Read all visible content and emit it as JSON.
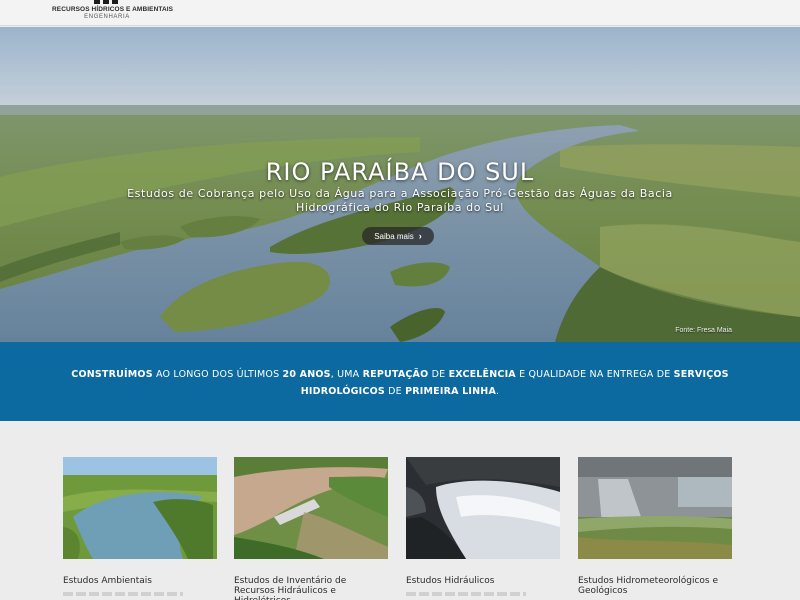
{
  "header": {
    "logo_line1": "RECURSOS HÍDRICOS E AMBIENTAIS",
    "logo_line2": "ENGENHARIA"
  },
  "hero": {
    "title": "RIO PARAÍBA DO SUL",
    "subtitle": "Estudos de Cobrança pelo Uso da Água para a Associação Pró-Gestão das Águas da Bacia Hidrográfica do Rio Paraíba do Sul",
    "button_label": "Saiba mais",
    "credit": "Fonte: Fresa Maia"
  },
  "banner": {
    "parts": [
      {
        "text": "CONSTRUÍMOS",
        "bold": true
      },
      {
        "text": " AO LONGO DOS ÚLTIMOS ",
        "bold": false
      },
      {
        "text": "20 ANOS",
        "bold": true
      },
      {
        "text": ", UMA ",
        "bold": false
      },
      {
        "text": "REPUTAÇÃO",
        "bold": true
      },
      {
        "text": " DE ",
        "bold": false
      },
      {
        "text": "EXCELÊNCIA",
        "bold": true
      },
      {
        "text": " E QUALIDADE NA ENTREGA DE ",
        "bold": false
      },
      {
        "text": "SERVIÇOS HIDROLÓGICOS",
        "bold": true
      },
      {
        "text": " DE ",
        "bold": false
      },
      {
        "text": "PRIMEIRA LINHA",
        "bold": true
      },
      {
        "text": ".",
        "bold": false
      }
    ]
  },
  "services": [
    {
      "label": "Estudos Ambientais"
    },
    {
      "label": "Estudos de Inventário de Recursos Hidráulicos e Hidrelétricos"
    },
    {
      "label": "Estudos Hidráulicos"
    },
    {
      "label": "Estudos Hidrometeorológicos e Geológicos"
    }
  ],
  "colors": {
    "banner": "#0d6aa0",
    "header": "#f3f3f3",
    "page_bg": "#ececec"
  }
}
